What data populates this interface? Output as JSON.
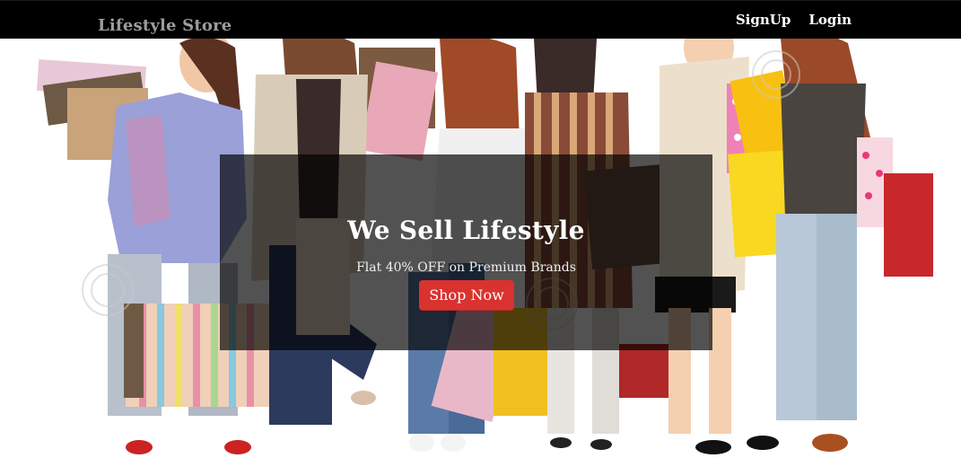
{
  "navbar": {
    "brand": "Lifestyle Store",
    "links": [
      {
        "label": "SignUp"
      },
      {
        "label": "Login"
      }
    ]
  },
  "banner": {
    "title": "We Sell Lifestyle",
    "subtitle": "Flat 40% OFF on Premium Brands",
    "cta_label": "Shop Now"
  },
  "colors": {
    "navbar_bg": "#000000",
    "brand_text": "#9d9d9d",
    "cta_bg": "#d9322f",
    "banner_overlay": "rgba(0,0,0,0.68)"
  },
  "hero_image": {
    "description_icon": "shopping-women-photo"
  }
}
